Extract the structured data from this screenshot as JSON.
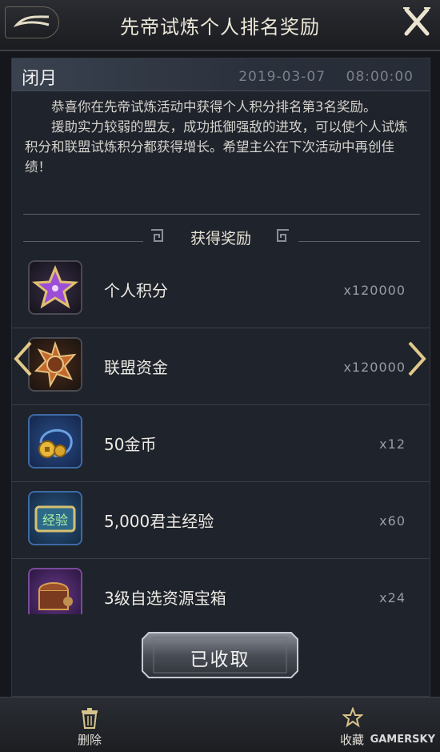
{
  "header": {
    "title": "先帝试炼个人排名奖励",
    "back_icon": "back-arrow-icon",
    "close_icon": "close-x-icon"
  },
  "mail": {
    "sender": "闭月",
    "date": "2019-03-07",
    "time": "08:00:00",
    "paragraph1": "恭喜你在先帝试炼活动中获得个人积分排名第3名奖励。",
    "paragraph2": "援助实力较弱的盟友，成功抵御强敌的进攻，可以使个人试炼积分和联盟试炼积分都获得增长。希望主公在下次活动中再创佳绩！"
  },
  "rewards": {
    "section_title": "获得奖励",
    "items": [
      {
        "name": "个人积分",
        "qty": "x120000",
        "icon": "purple-star-icon"
      },
      {
        "name": "联盟资金",
        "qty": "x120000",
        "icon": "alliance-emblem-icon"
      },
      {
        "name": "50金币",
        "qty": "x12",
        "icon": "gold-coin-icon"
      },
      {
        "name": "5,000君主经验",
        "qty": "x60",
        "icon": "experience-scroll-icon"
      },
      {
        "name": "3级自选资源宝箱",
        "qty": "x24",
        "icon": "treasure-chest-icon"
      }
    ]
  },
  "nav": {
    "left_arrow_icon": "chevron-left-icon",
    "right_arrow_icon": "chevron-right-icon"
  },
  "received_button": {
    "label": "已收取"
  },
  "footer": {
    "delete_label": "删除",
    "delete_icon": "trash-icon",
    "favorite_label": "收藏",
    "favorite_icon": "star-outline-icon"
  },
  "watermark": "GAMERSKY",
  "colors": {
    "background": "#15171c",
    "panel": "#1f232b",
    "gold_accent": "#d9c48a",
    "text": "#e8e8ea"
  }
}
